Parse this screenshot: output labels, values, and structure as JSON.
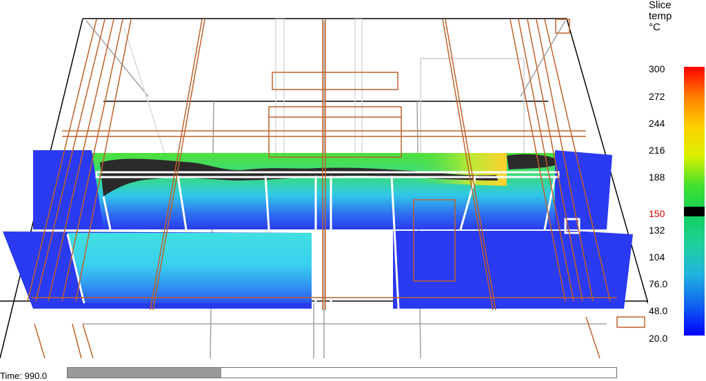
{
  "app": {
    "view": "3d-smoke-view"
  },
  "colorbar": {
    "title_lines": [
      "Slice",
      "temp",
      "°C"
    ],
    "ticks": [
      "300",
      "272",
      "244",
      "216",
      "188",
      "150",
      "132",
      "104",
      "76.0",
      "48.0",
      "20.0"
    ],
    "highlight_tick": "150",
    "highlight_color": "#e00000",
    "gradient_colors": [
      "#ff0000",
      "#ff8000",
      "#ffd000",
      "#d8f000",
      "#40e030",
      "#10d060",
      "#20d0a0",
      "#20b0e0",
      "#1060f0",
      "#0000ff"
    ]
  },
  "timebar": {
    "label": "Time: 990.0",
    "progress_fraction": 0.28
  },
  "colors": {
    "wall_orange": "#c0602a",
    "frame_gray": "#909090",
    "slice_blue": "#2a3af0",
    "slice_cyan": "#40d8e8",
    "slice_green": "#48e040",
    "smoke_black": "#2a2a2a"
  }
}
